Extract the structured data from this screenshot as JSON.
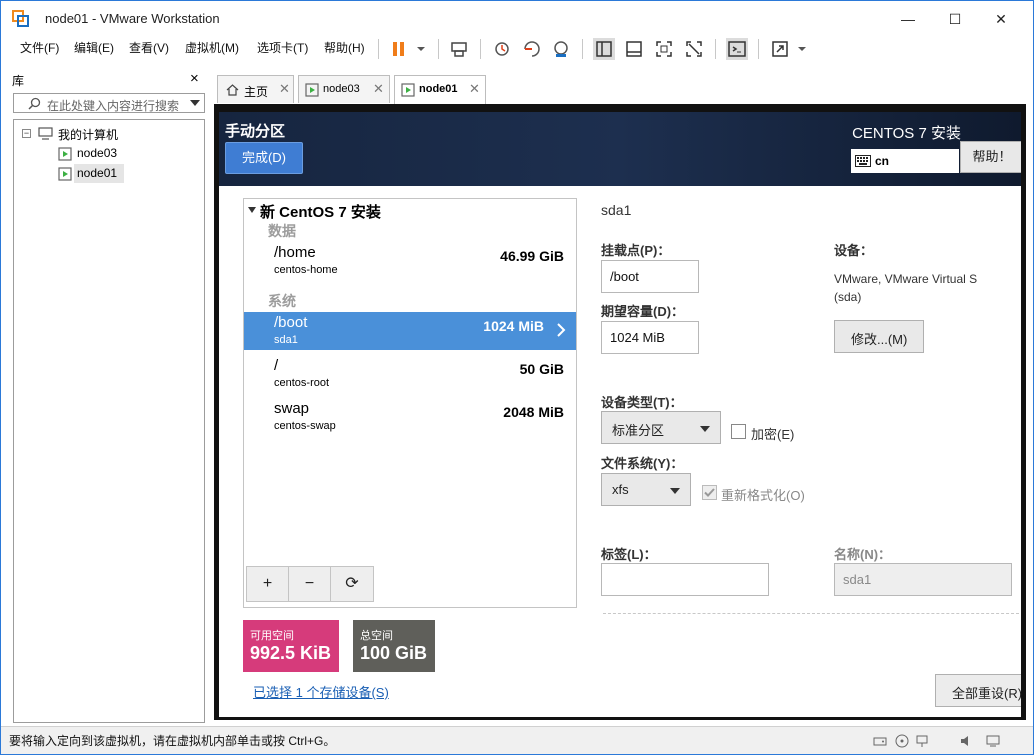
{
  "window": {
    "title": "node01 - VMware Workstation",
    "minimize": "—",
    "maximize": "☐",
    "close": "✕"
  },
  "menu": [
    "文件(F)",
    "编辑(E)",
    "查看(V)",
    "虚拟机(M)",
    "选项卡(T)",
    "帮助(H)"
  ],
  "library": {
    "title": "库",
    "close": "×",
    "search_placeholder": "在此处键入内容进行搜索",
    "root": "我的计算机",
    "vms": [
      "node03",
      "node01"
    ]
  },
  "tabs": [
    {
      "label": "主页"
    },
    {
      "label": "node03"
    },
    {
      "label": "node01"
    }
  ],
  "installer": {
    "screen_title": "手动分区",
    "done_button": "完成(D)",
    "product_title": "CENTOS 7 安装",
    "keyboard": "cn",
    "help_button": "帮助！",
    "tree_root": "新 CentOS 7 安装",
    "group_data": "数据",
    "group_system": "系统",
    "partitions": [
      {
        "mount": "/home",
        "device": "centos-home",
        "size": "46.99 GiB"
      },
      {
        "mount": "/boot",
        "device": "sda1",
        "size": "1024 MiB"
      },
      {
        "mount": "/",
        "device": "centos-root",
        "size": "50 GiB"
      },
      {
        "mount": "swap",
        "device": "centos-swap",
        "size": "2048 MiB"
      }
    ],
    "add": "+",
    "remove": "−",
    "refresh": "⟳",
    "available_label": "可用空间",
    "available_value": "992.5 KiB",
    "total_label": "总空间",
    "total_value": "100 GiB",
    "storage_link": "已选择 1 个存储设备(S)",
    "detail": {
      "title": "sda1",
      "mount_label": "挂载点(P)：",
      "mount_value": "/boot",
      "capacity_label": "期望容量(D)：",
      "capacity_value": "1024 MiB",
      "device_label": "设备：",
      "device_value_1": "VMware, VMware Virtual S",
      "device_value_2": "(sda)",
      "modify_button": "修改...(M)",
      "device_type_label": "设备类型(T)：",
      "device_type_value": "标准分区",
      "encrypt_label": "加密(E)",
      "fs_label": "文件系统(Y)：",
      "fs_value": "xfs",
      "reformat_label": "重新格式化(O)",
      "tag_label": "标签(L)：",
      "tag_value": "",
      "name_label": "名称(N)：",
      "name_value": "sda1",
      "reset_button": "全部重设(R)"
    }
  },
  "status": {
    "text": "要将输入定向到该虚拟机，请在虚拟机内部单击或按 Ctrl+G。"
  },
  "colors": {
    "accent": "#4a90d9",
    "available": "#d63b7b",
    "total": "#5f5f5a"
  }
}
